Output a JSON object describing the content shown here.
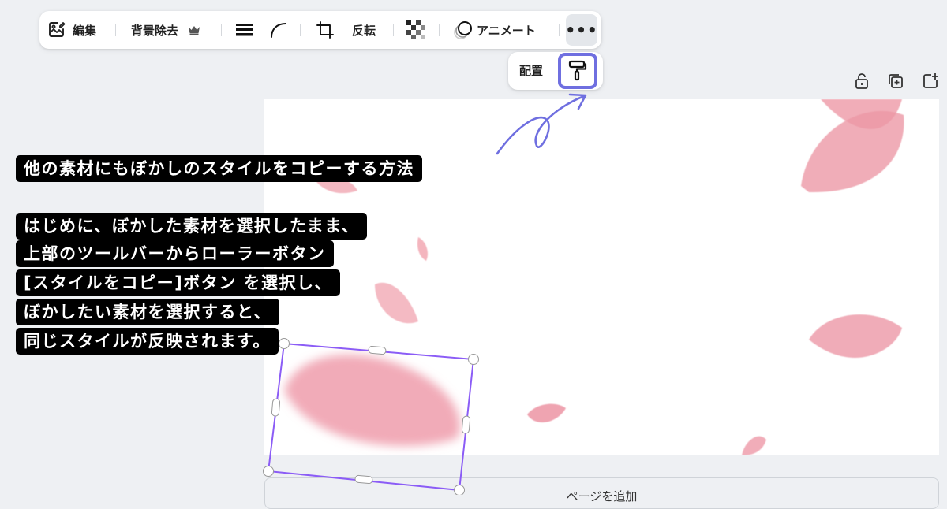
{
  "toolbar": {
    "edit_label": "編集",
    "remove_bg_label": "背景除去",
    "flip_label": "反転",
    "animate_label": "アニメート",
    "more_label": "•••"
  },
  "popover": {
    "position_label": "配置"
  },
  "canvas": {
    "add_page_label": "ページを追加"
  },
  "captions": {
    "title": "他の素材にもぼかしのスタイルをコピーする方法",
    "lines": [
      "はじめに、ぼかした素材を選択したまま、",
      "上部のツールバーからローラーボタン",
      "[スタイルをコピー]ボタン を選択し、",
      "ぼかしたい素材を選択すると、",
      "同じスタイルが反映されます。"
    ]
  },
  "colors": {
    "highlight": "#6f6fe0",
    "selection": "#8b5cf6",
    "caption_bg": "#000000",
    "petal": "#ec9aa8",
    "canvas_bg": "#ffffff",
    "workspace_bg": "#eef0f3"
  },
  "icons": {
    "edit": "image-edit-icon",
    "premium": "crown-icon",
    "border": "border-lines-icon",
    "corner": "corner-rounding-icon",
    "crop": "crop-icon",
    "transparency": "transparency-checker-icon",
    "animate": "animate-circles-icon",
    "copy_style": "paint-roller-icon",
    "lock": "lock-icon",
    "duplicate": "duplicate-page-icon",
    "add_page": "add-page-icon"
  }
}
